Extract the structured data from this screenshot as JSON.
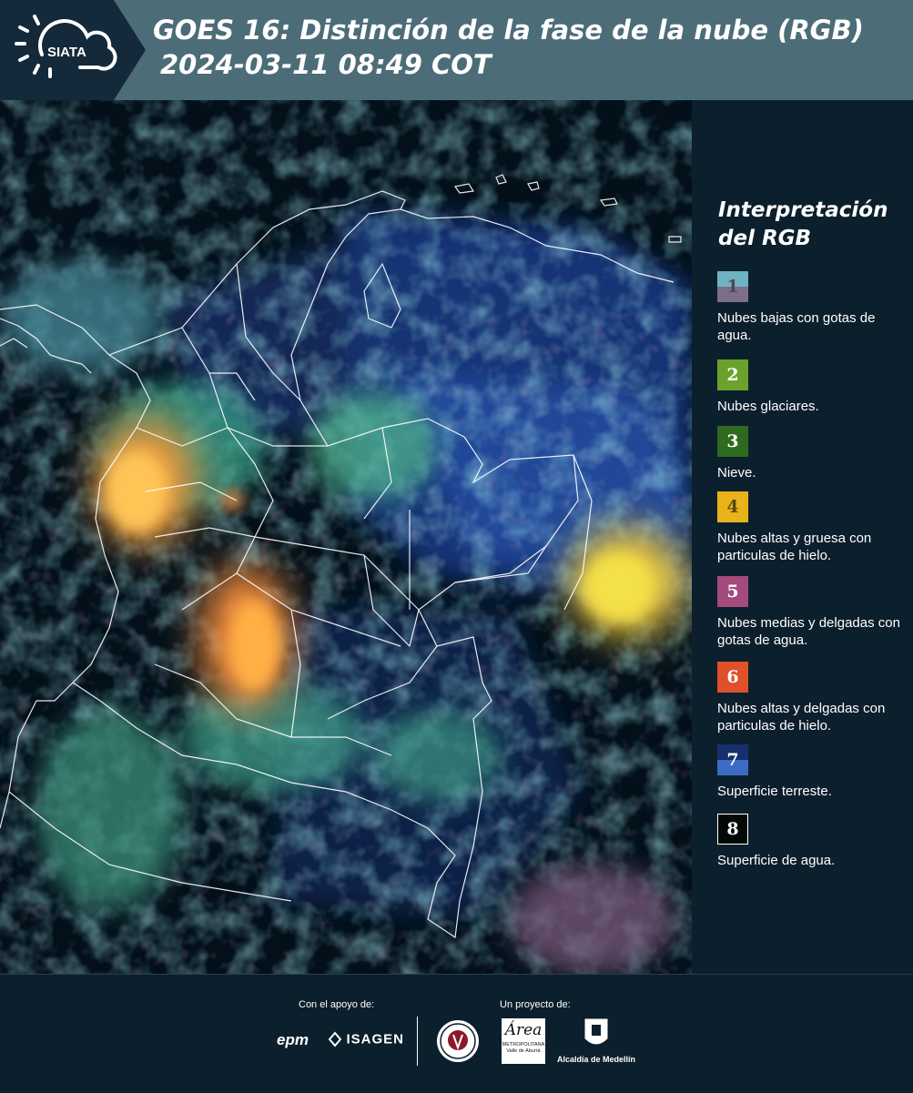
{
  "header": {
    "logo_text": "SIATA",
    "title_line1": "GOES 16: Distinción de la fase de la nube (RGB)",
    "title_line2": "2024-03-11 08:49 COT"
  },
  "legend": {
    "title": "Interpretación del RGB",
    "items": [
      {
        "number": "1",
        "label": "Nubes bajas con gotas de agua.",
        "colors": [
          "#6fb3c2",
          "#7d6f87"
        ],
        "text_color": "#4a4a55"
      },
      {
        "number": "2",
        "label": "Nubes glaciares.",
        "colors": [
          "#6aa22c"
        ],
        "text_color": "#ffffff"
      },
      {
        "number": "3",
        "label": "Nieve.",
        "colors": [
          "#2e6b1e"
        ],
        "text_color": "#ffffff"
      },
      {
        "number": "4",
        "label": "Nubes altas y gruesa con particulas de hielo.",
        "colors": [
          "#e8b41a"
        ],
        "text_color": "#5a4a10"
      },
      {
        "number": "5",
        "label": "Nubes medias y delgadas con gotas de agua.",
        "colors": [
          "#a44a7c"
        ],
        "text_color": "#ffffff"
      },
      {
        "number": "6",
        "label": "Nubes altas y delgadas con particulas de hielo.",
        "colors": [
          "#e0502a"
        ],
        "text_color": "#ffffff"
      },
      {
        "number": "7",
        "label": "Superficie terreste.",
        "colors": [
          "#16306e",
          "#3b6bc4"
        ],
        "text_color": "#ffffff"
      },
      {
        "number": "8",
        "label": "Superficie de agua.",
        "colors": [
          "#020a06"
        ],
        "text_color": "#ffffff"
      }
    ]
  },
  "footer": {
    "support_caption": "Con el apoyo de:",
    "project_caption": "Un proyecto de:",
    "sponsors": [
      "epm",
      "ISAGEN"
    ],
    "area_logo_text": "Área",
    "area_logo_sub1": "METROPOLITANA",
    "area_logo_sub2": "Valle de Aburrá",
    "alcaldia_text": "Alcaldía de Medellín"
  }
}
